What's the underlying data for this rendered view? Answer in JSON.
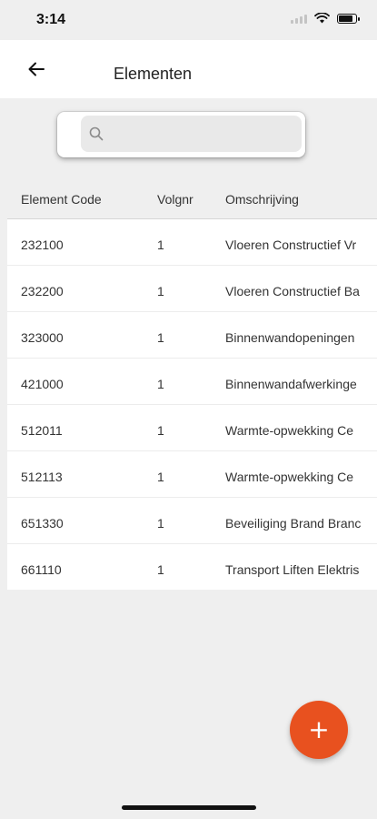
{
  "status": {
    "time": "3:14"
  },
  "header": {
    "title": "Elementen",
    "back_icon": "arrow-left-icon"
  },
  "search": {
    "placeholder": "",
    "value": ""
  },
  "table": {
    "columns": [
      "Element Code",
      "Volgnr",
      "Omschrijving"
    ],
    "rows": [
      {
        "code": "232100",
        "volgnr": "1",
        "omschrijving": "Vloeren Constructief Vr"
      },
      {
        "code": "232200",
        "volgnr": "1",
        "omschrijving": "Vloeren Constructief Ba"
      },
      {
        "code": "323000",
        "volgnr": "1",
        "omschrijving": "Binnenwandopeningen"
      },
      {
        "code": "421000",
        "volgnr": "1",
        "omschrijving": "Binnenwandafwerkinge"
      },
      {
        "code": "512011",
        "volgnr": "1",
        "omschrijving": "Warmte-opwekking Ce"
      },
      {
        "code": "512113",
        "volgnr": "1",
        "omschrijving": "Warmte-opwekking Ce"
      },
      {
        "code": "651330",
        "volgnr": "1",
        "omschrijving": "Beveiliging Brand Branc"
      },
      {
        "code": "661110",
        "volgnr": "1",
        "omschrijving": "Transport Liften Elektris"
      }
    ]
  },
  "fab": {
    "label": "+"
  },
  "colors": {
    "accent": "#e8511f",
    "background": "#efefef"
  }
}
